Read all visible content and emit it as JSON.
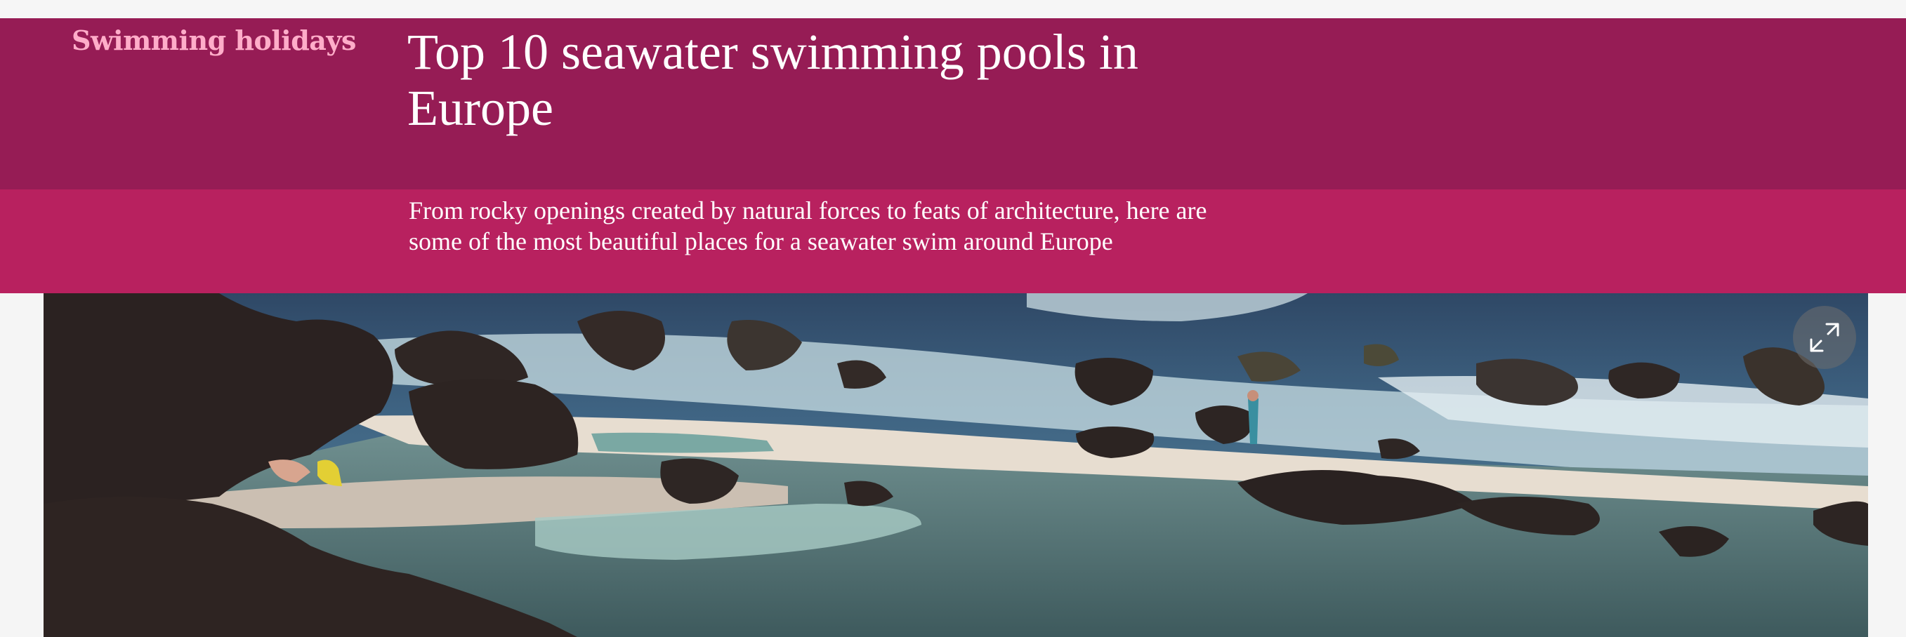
{
  "header": {
    "kicker": "Swimming holidays",
    "headline": "Top 10 seawater swimming pools in Europe",
    "standfirst": "From rocky openings created by natural forces to feats of architecture, here are some of the most beautiful places for a seawater swim around Europe"
  },
  "hero": {
    "expand_icon": "expand-arrows-icon"
  },
  "colors": {
    "headline_band": "#961c55",
    "standfirst_band": "#b8215f",
    "kicker_text": "#ffadc9",
    "page_background": "#f5f5f5"
  }
}
